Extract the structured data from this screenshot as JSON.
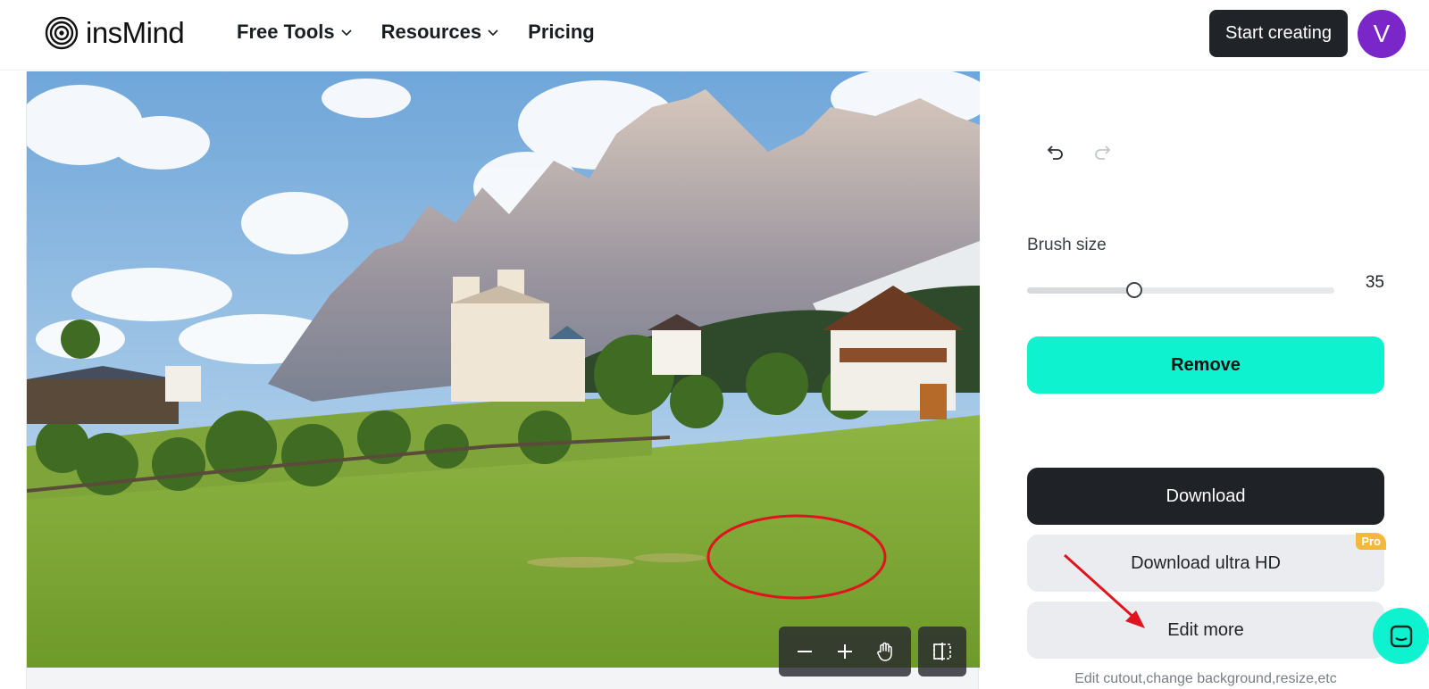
{
  "brand": {
    "name": "insMind"
  },
  "nav": [
    {
      "label": "Free Tools",
      "has_dropdown": true
    },
    {
      "label": "Resources",
      "has_dropdown": true
    },
    {
      "label": "Pricing",
      "has_dropdown": false
    }
  ],
  "header": {
    "cta_label": "Start creating",
    "avatar_initial": "V"
  },
  "canvas": {
    "tools": {
      "zoom_out_icon": "minus-icon",
      "zoom_in_icon": "plus-icon",
      "pan_icon": "hand-icon",
      "compare_icon": "compare-icon"
    }
  },
  "panel": {
    "undo_icon": "undo-icon",
    "redo_icon": "redo-icon",
    "brush_label": "Brush size",
    "brush_value": "35",
    "brush_fraction": 0.35,
    "remove_label": "Remove",
    "download_label": "Download",
    "download_hd_label": "Download ultra HD",
    "pro_badge": "Pro",
    "edit_more_label": "Edit more",
    "edit_hint": "Edit cutout,change background,resize,etc"
  },
  "colors": {
    "accent": "#0ef2cf",
    "dark": "#1f2328",
    "avatar": "#7b26c9",
    "pro": "#f5b93a",
    "annotation": "#e0141e"
  }
}
